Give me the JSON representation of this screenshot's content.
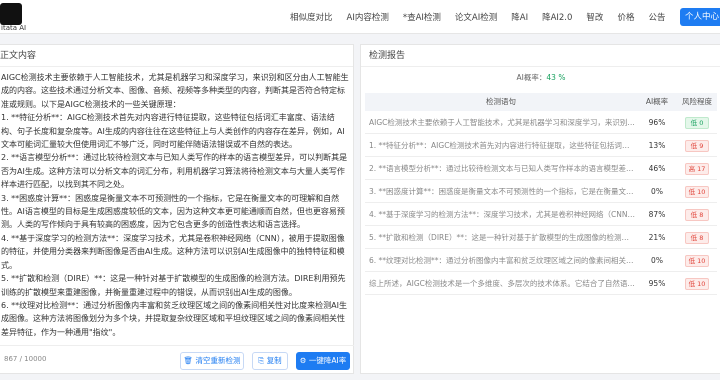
{
  "brand": {
    "name": "itata AI"
  },
  "nav": {
    "items": [
      "相似度对比",
      "AI内容检测",
      "*查AI检测",
      "论文AI检测",
      "降AI",
      "降AI2.0",
      "智改",
      "价格",
      "公告"
    ],
    "user_center": "个人中心"
  },
  "left": {
    "title": "正文内容",
    "text": "AIGC检测技术主要依赖于人工智能技术，尤其是机器学习和深度学习，来识别和区分由人工智能生成的内容。这些技术通过分析文本、图像、音频、视频等多种类型的内容，判断其是否符合特定标准或规则。以下是AIGC检测技术的一些关键原理：\n1. **特征分析**：AIGC检测技术首先对内容进行特征提取，这些特征包括词汇丰富度、语法结构、句子长度和复杂度等。AI生成的内容往往在这些特征上与人类创作的内容存在差异，例如，AI文本可能词汇量较大但使用词汇不够广泛，同时可能伴随语法错误或不自然的表达。\n2. **语言模型分析**：通过比较待检测文本与已知人类写作的样本的语言模型差异，可以判断其是否为AI生成。这种方法可以分析文本的词汇分布，利用机器学习算法将待检测文本与大量人类写作样本进行匹配，以找到其不同之处。\n3. **困惑度计算**：困惑度是衡量文本不可预测性的一个指标，它是在衡量文本的可理解和自然性。AI语言模型的目标是生成困惑度较低的文本，因为这种文本更可能通顺而自然，但也更容易预测。人类的写作倾向于具有较高的困惑度，因为它包含更多的创造性表达和语言选择。\n4. **基于深度学习的检测方法**：深度学习技术，尤其是卷积神经网络（CNN），被用于提取图像的特征，并使用分类器来判断图像是否由AI生成。这种方法可以识别AI生成图像中的独特特征和模式。\n5. **扩散和检测（DIRE）**：这是一种针对基于扩散模型的生成图像的检测方法。DIRE利用预先训练的扩散模型来重建图像，并衡量重建过程中的错误，从而识别出AI生成的图像。\n6. **纹理对比检测**：通过分析图像内丰富和贫乏纹理区域之间的像素间相关性对比度来检测AI生成图像。这种方法将图像划分为多个块，并提取复杂纹理区域和平坦纹理区域之间的像素间相关性差异特征，作为一种通用\"指纹\"。\n综上所述，AIGC检测技术是一个多维度、多层次的技术体系。它结合了自然语言处理、机器学习、深",
    "counter": "867 / 10000",
    "buttons": {
      "clear": "清空重新检测",
      "copy": "复制",
      "rewrite": "一键降AI率"
    }
  },
  "right": {
    "title": "检测报告",
    "ai_rate_label": "AI概率：",
    "ai_rate_value": "43 %",
    "columns": [
      "检测语句",
      "AI概率",
      "风险程度"
    ],
    "rows": [
      {
        "text": "AIGC检测技术主要依赖于人工智能技术，尤其是机器学习和深度学习，来识别和区分由人工智能生成的内容。",
        "pct": "96%",
        "badge": "低 0",
        "level": "safe"
      },
      {
        "text": "1. **特征分析**：AIGC检测技术首先对内容进行特征提取，这些特征包括词汇丰富度、语法结构...",
        "pct": "13%",
        "badge": "低 9",
        "level": "risk"
      },
      {
        "text": "2. **语言模型分析**：通过比较待检测文本与已知人类写作样本的语言模型差异，可以判断其是否为AI生成",
        "pct": "46%",
        "badge": "高 17",
        "level": "risk"
      },
      {
        "text": "3. **困惑度计算**：困惑度是衡量文本不可预测性的一个指标，它是在衡量文本的可理解和自然性",
        "pct": "0%",
        "badge": "低 10",
        "level": "risk"
      },
      {
        "text": "4. **基于深度学习的检测方法**：深度学习技术，尤其是卷积神经网络（CNN），被用于提取图像的特征",
        "pct": "87%",
        "badge": "低 8",
        "level": "risk"
      },
      {
        "text": "5. **扩散和检测（DIRE）**：这是一种针对基于扩散模型的生成图像的检测方法。DIRE利用预先训练",
        "pct": "21%",
        "badge": "低 8",
        "level": "risk"
      },
      {
        "text": "6. **纹理对比检测**：通过分析图像内丰富和贫乏纹理区域之间的像素间相关性对比度来检测",
        "pct": "0%",
        "badge": "低 10",
        "level": "risk"
      },
      {
        "text": "综上所述，AIGC检测技术是一个多维度、多层次的技术体系。它结合了自然语言处理、机器学习、深",
        "pct": "95%",
        "badge": "低 10",
        "level": "risk"
      }
    ]
  }
}
